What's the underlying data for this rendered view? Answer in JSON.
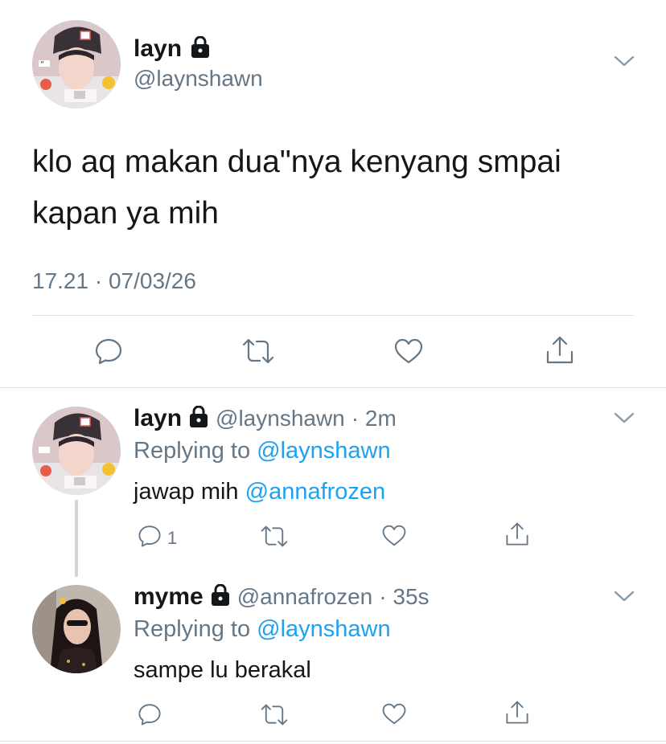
{
  "main_tweet": {
    "author_name": "layn",
    "author_handle": "@laynshawn",
    "text_line1": "klo aq makan dua\"nya kenyang smpai",
    "text_line2": "kapan ya mih",
    "timestamp": "17.21 · 07/03/26",
    "icons": [
      "reply-icon",
      "retweet-icon",
      "like-icon",
      "share-icon"
    ]
  },
  "replies": [
    {
      "author_name": "layn",
      "author_handle": "@laynshawn",
      "time": "· 2m",
      "replying_prefix": "Replying to ",
      "replying_handle": "@laynshawn",
      "text_prefix": "jawap mih ",
      "mention": "@annafrozen",
      "reply_count": "1"
    },
    {
      "author_name": "myme",
      "author_handle": "@annafrozen",
      "time": "· 35s",
      "replying_prefix": "Replying to ",
      "replying_handle": "@laynshawn",
      "text": "sampe lu berakal"
    }
  ],
  "colors": {
    "link": "#1da1f2",
    "secondary_text": "#657786",
    "divider": "#dfe3e6"
  }
}
